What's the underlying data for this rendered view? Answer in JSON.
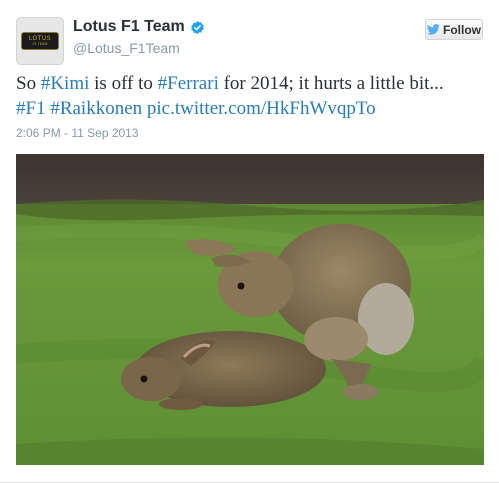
{
  "author": {
    "display_name": "Lotus F1 Team",
    "handle": "@Lotus_F1Team",
    "verified": true,
    "avatar_logo_text": "LOTUS",
    "avatar_logo_sub": "F1 TEAM"
  },
  "follow_button": {
    "label": "Follow",
    "icon": "twitter-bird-icon"
  },
  "tweet": {
    "segments": [
      {
        "text": "So ",
        "link": false
      },
      {
        "text": "#Kimi",
        "link": true
      },
      {
        "text": " is off to ",
        "link": false
      },
      {
        "text": "#Ferrari",
        "link": true
      },
      {
        "text": " for 2014; it hurts a little bit...",
        "link": false
      },
      {
        "text": "#F1",
        "link": true
      },
      {
        "text": " ",
        "link": false
      },
      {
        "text": "#Raikkonen",
        "link": true
      },
      {
        "text": " ",
        "link": false
      },
      {
        "text": "pic.twitter.com/HkFhWvqpTo",
        "link": true
      }
    ],
    "timestamp": "2:06 PM - 11 Sep 2013"
  },
  "colors": {
    "link": "#2b7bb9",
    "text": "#292f33",
    "muted": "#8899a6",
    "verified": "#1da1f2",
    "bird": "#55acee"
  },
  "photo": {
    "icon": "photo-image"
  }
}
